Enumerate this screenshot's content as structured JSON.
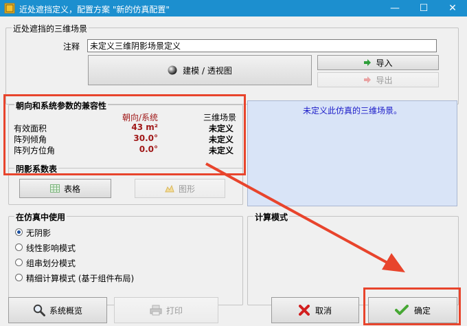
{
  "window": {
    "title": "近处遮挡定义，配置方案 \"新的仿真配置\"",
    "minimize_glyph": "—",
    "maximize_glyph": "☐",
    "close_glyph": "✕"
  },
  "scene_group": {
    "legend": "近处遮挡的三维场景",
    "comment_label": "注释",
    "comment_value": "未定义三维阴影场景定义",
    "build_button": "建模 / 透视图",
    "import_button": "导入",
    "export_button": "导出"
  },
  "compat": {
    "legend": "朝向和系统参数的兼容性",
    "col_orientation": "朝向/系统",
    "col_scene": "三维场景",
    "rows": [
      {
        "label": "有效面积",
        "orientation": "43 m²",
        "scene": "未定义"
      },
      {
        "label": "阵列倾角",
        "orientation": "30.0°",
        "scene": "未定义"
      },
      {
        "label": "阵列方位角",
        "orientation": "0.0°",
        "scene": "未定义"
      }
    ]
  },
  "info_panel": {
    "message": "未定义此仿真的三维场景。"
  },
  "shading_table": {
    "legend": "阴影系数表",
    "table_button": "表格",
    "graph_button": "图形"
  },
  "use_in_sim": {
    "legend": "在仿真中使用",
    "options": [
      "无阴影",
      "线性影响模式",
      "组串划分模式",
      "精细计算模式 (基于组件布局)"
    ],
    "selected_index": 0
  },
  "calc_mode": {
    "legend": "计算模式"
  },
  "footer": {
    "overview_button": "系统概览",
    "print_button": "打印",
    "cancel_button": "取消",
    "ok_button": "确定"
  },
  "colors": {
    "titlebar": "#1c8fcf",
    "highlight": "#e8442c",
    "info_panel_bg": "#d9e4f7",
    "info_text": "#1a1ac8",
    "orientation_value": "#a01818"
  }
}
